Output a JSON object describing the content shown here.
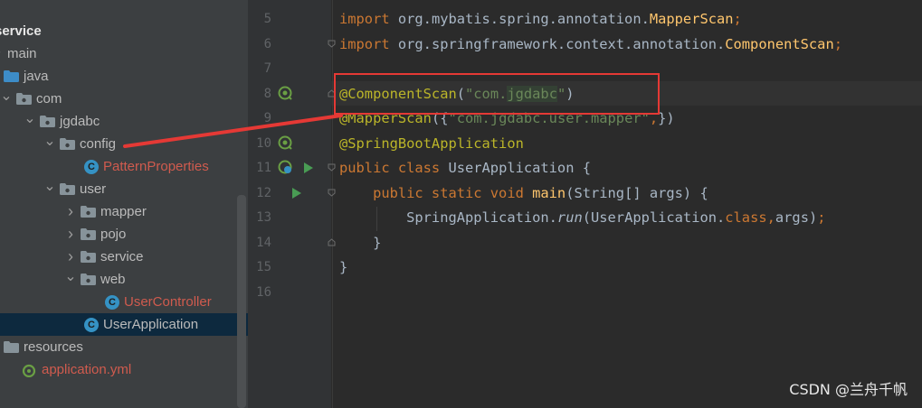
{
  "project_tree": {
    "items": [
      {
        "label": "service",
        "depth": 0,
        "kind": "module",
        "expanded": null
      },
      {
        "label": "main",
        "depth": 0,
        "kind": "folder",
        "expanded": true
      },
      {
        "label": "java",
        "depth": 0,
        "kind": "source-folder",
        "expanded": null
      },
      {
        "label": "com",
        "depth": 1,
        "kind": "package",
        "expanded": true
      },
      {
        "label": "jgdabc",
        "depth": 2,
        "kind": "package",
        "expanded": true
      },
      {
        "label": "config",
        "depth": 3,
        "kind": "package",
        "expanded": true
      },
      {
        "label": "PatternProperties",
        "depth": 4,
        "kind": "class",
        "expanded": null
      },
      {
        "label": "user",
        "depth": 3,
        "kind": "package",
        "expanded": true
      },
      {
        "label": "mapper",
        "depth": 4,
        "kind": "package",
        "expanded": false
      },
      {
        "label": "pojo",
        "depth": 4,
        "kind": "package",
        "expanded": false
      },
      {
        "label": "service",
        "depth": 4,
        "kind": "package",
        "expanded": false
      },
      {
        "label": "web",
        "depth": 4,
        "kind": "package",
        "expanded": true
      },
      {
        "label": "UserController",
        "depth": 5,
        "kind": "class",
        "expanded": null
      },
      {
        "label": "UserApplication",
        "depth": 4,
        "kind": "spring-class",
        "expanded": null
      },
      {
        "label": "resources",
        "depth": 0,
        "kind": "resources-folder",
        "expanded": null
      },
      {
        "label": "application.yml",
        "depth": 1,
        "kind": "yml",
        "expanded": null
      }
    ],
    "selected": "UserApplication"
  },
  "editor": {
    "line_numbers": [
      "5",
      "6",
      "7",
      "8",
      "9",
      "10",
      "11",
      "12",
      "13",
      "14",
      "15",
      "16"
    ],
    "lines": [
      [
        {
          "t": "import ",
          "c": "kw"
        },
        {
          "t": "org.mybatis.spring.annotation.",
          "c": "plain"
        },
        {
          "t": "MapperScan",
          "c": "fn"
        },
        {
          "t": ";",
          "c": "kw"
        }
      ],
      [
        {
          "t": "import ",
          "c": "kw"
        },
        {
          "t": "org.springframework.context.annotation.",
          "c": "plain"
        },
        {
          "t": "ComponentScan",
          "c": "fn"
        },
        {
          "t": ";",
          "c": "kw"
        }
      ],
      [],
      [
        {
          "t": "@ComponentScan",
          "c": "ann"
        },
        {
          "t": "(",
          "c": "plain"
        },
        {
          "t": "\"com.",
          "c": "str"
        },
        {
          "t": "jgdabc",
          "c": "str-hl"
        },
        {
          "t": "\"",
          "c": "str"
        },
        {
          "t": ")",
          "c": "plain"
        }
      ],
      [
        {
          "t": "@MapperScan",
          "c": "ann"
        },
        {
          "t": "({",
          "c": "plain"
        },
        {
          "t": "\"com.jgdabc.user.mapper\"",
          "c": "str"
        },
        {
          "t": ",",
          "c": "kw"
        },
        {
          "t": "})",
          "c": "plain"
        }
      ],
      [
        {
          "t": "@SpringBootApplication",
          "c": "ann"
        }
      ],
      [
        {
          "t": "public class ",
          "c": "kw"
        },
        {
          "t": "UserApplication {",
          "c": "plain"
        }
      ],
      [
        {
          "t": "    public static void ",
          "c": "kw"
        },
        {
          "t": "main",
          "c": "fn"
        },
        {
          "t": "(String[] args) {",
          "c": "plain"
        }
      ],
      [
        {
          "t": "        SpringApplication.",
          "c": "plain"
        },
        {
          "t": "run",
          "c": "it"
        },
        {
          "t": "(UserApplication.",
          "c": "plain"
        },
        {
          "t": "class",
          "c": "kw"
        },
        {
          "t": ",",
          "c": "kw"
        },
        {
          "t": "args)",
          "c": "plain"
        },
        {
          "t": ";",
          "c": "kw"
        }
      ],
      [
        {
          "t": "    }",
          "c": "plain"
        }
      ],
      [
        {
          "t": "}",
          "c": "plain"
        }
      ],
      []
    ]
  },
  "watermark": "CSDN @兰舟千帆",
  "colors": {
    "annotation_box": "#e53935",
    "arrow": "#e53935"
  }
}
